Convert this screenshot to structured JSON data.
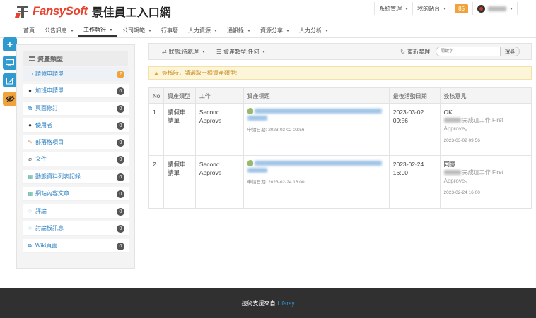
{
  "brand": {
    "name": "FansySoft",
    "title": "景佳員工入口網"
  },
  "topbar": {
    "system_admin": "系統管理",
    "my_sites": "我的站台",
    "notifications": "85"
  },
  "nav": {
    "items": [
      "首頁",
      "公告訊息",
      "工作執行",
      "公司規範",
      "行事曆",
      "人力資源",
      "通訊錄",
      "資源分享",
      "人力分析"
    ]
  },
  "sidebar": {
    "header": "資產類型",
    "items": [
      {
        "label": "請假申請單",
        "count": "2"
      },
      {
        "label": "加班申請單",
        "count": "0"
      },
      {
        "label": "頁面修訂",
        "count": "0"
      },
      {
        "label": "使用者",
        "count": "0"
      },
      {
        "label": "部落格項目",
        "count": "0"
      },
      {
        "label": "文件",
        "count": "0"
      },
      {
        "label": "動態資料列表記錄",
        "count": "0"
      },
      {
        "label": "網站內容文章",
        "count": "0"
      },
      {
        "label": "評論",
        "count": "0"
      },
      {
        "label": "討論板訊息",
        "count": "0"
      },
      {
        "label": "Wiki頁面",
        "count": "0"
      }
    ]
  },
  "toolbar": {
    "status_filter": "狀態:待處理",
    "type_filter": "資產類型:任何",
    "refresh": "重新整理",
    "search_placeholder": "關鍵字",
    "search_button": "搜尋"
  },
  "alert": {
    "text": "簽核時，請選取一種資產類型!"
  },
  "table": {
    "headers": [
      "No.",
      "資產類型",
      "工作",
      "資產標題",
      "最後活動日期",
      "簽核意見"
    ],
    "rows": [
      {
        "no": "1.",
        "type": "請假申請單",
        "task": "Second Approve",
        "applied": "申請日期: 2023-03-02 09:56",
        "last_date": "2023-03-02 09:56",
        "opinion": "OK",
        "opinion_note": "完成這工作 First Approve。",
        "opinion_date": "2023-03-02 09:56"
      },
      {
        "no": "2.",
        "type": "請假申請單",
        "task": "Second Approve",
        "applied": "申請日期: 2023-02-24 16:00",
        "last_date": "2023-02-24 16:00",
        "opinion": "同意",
        "opinion_note": "完成這工作 First Approve。",
        "opinion_date": "2023-02-24 16:00"
      }
    ]
  },
  "footer": {
    "text": "技術支援來自",
    "link": "Liferay"
  },
  "colors": {
    "brand_red": "#e8412c",
    "accent_blue": "#2e9ad0",
    "badge_orange": "#f0a33a",
    "footer_bg": "#303030"
  }
}
